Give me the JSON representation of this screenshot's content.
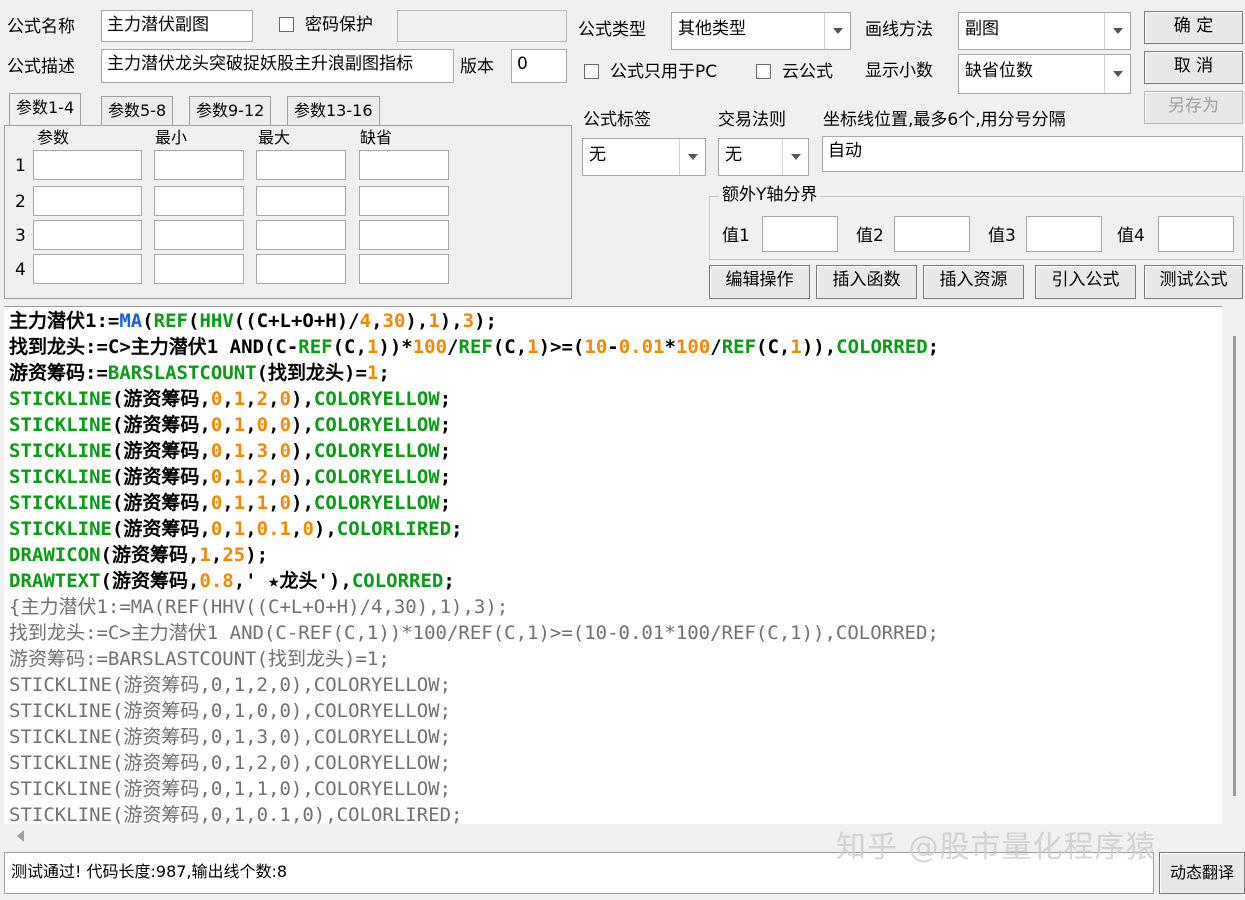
{
  "formula": {
    "name_label": "公式名称",
    "name_value": "主力潜伏副图",
    "password_label": "密码保护",
    "desc_label": "公式描述",
    "desc_value": "主力潜伏龙头突破捉妖股主升浪副图指标",
    "version_label": "版本",
    "version_value": "0",
    "type_label": "公式类型",
    "type_value": "其他类型",
    "draw_label": "画线方法",
    "draw_value": "副图",
    "pc_only_label": "公式只用于PC",
    "cloud_label": "云公式",
    "decimals_label": "显示小数",
    "decimals_value": "缺省位数",
    "tag_label": "公式标签",
    "tag_value": "无",
    "rule_label": "交易法则",
    "rule_value": "无",
    "coord_label": "坐标线位置,最多6个,用分号分隔",
    "coord_value": "自动"
  },
  "buttons": {
    "ok": "确 定",
    "cancel": "取 消",
    "save_as": "另存为",
    "edit_ops": "编辑操作",
    "insert_func": "插入函数",
    "insert_res": "插入资源",
    "import_formula": "引入公式",
    "test_formula": "测试公式",
    "dynamic_translate": "动态翻译"
  },
  "tabs": [
    "参数1-4",
    "参数5-8",
    "参数9-12",
    "参数13-16"
  ],
  "params": {
    "headers": [
      "参数",
      "最小",
      "最大",
      "缺省"
    ],
    "rows": [
      "1",
      "2",
      "3",
      "4"
    ]
  },
  "yaxis": {
    "title": "额外Y轴分界",
    "labels": [
      "值1",
      "值2",
      "值3",
      "值4"
    ]
  },
  "code_lines": [
    [
      {
        "t": "主力潜伏1:=",
        "c": "d"
      },
      {
        "t": "MA",
        "c": "b"
      },
      {
        "t": "(",
        "c": "d"
      },
      {
        "t": "REF",
        "c": "k"
      },
      {
        "t": "(",
        "c": "d"
      },
      {
        "t": "HHV",
        "c": "k"
      },
      {
        "t": "((C+L+O+H)/",
        "c": "d"
      },
      {
        "t": "4",
        "c": "n"
      },
      {
        "t": ",",
        "c": "d"
      },
      {
        "t": "30",
        "c": "n"
      },
      {
        "t": "),",
        "c": "d"
      },
      {
        "t": "1",
        "c": "n"
      },
      {
        "t": "),",
        "c": "d"
      },
      {
        "t": "3",
        "c": "n"
      },
      {
        "t": ");",
        "c": "d"
      }
    ],
    [
      {
        "t": "找到龙头:=C>主力潜伏1 AND(C-",
        "c": "d"
      },
      {
        "t": "REF",
        "c": "k"
      },
      {
        "t": "(C,",
        "c": "d"
      },
      {
        "t": "1",
        "c": "n"
      },
      {
        "t": "))*",
        "c": "d"
      },
      {
        "t": "100",
        "c": "n"
      },
      {
        "t": "/",
        "c": "d"
      },
      {
        "t": "REF",
        "c": "k"
      },
      {
        "t": "(C,",
        "c": "d"
      },
      {
        "t": "1",
        "c": "n"
      },
      {
        "t": ")>=(",
        "c": "d"
      },
      {
        "t": "10",
        "c": "n"
      },
      {
        "t": "-",
        "c": "d"
      },
      {
        "t": "0.01",
        "c": "n"
      },
      {
        "t": "*",
        "c": "d"
      },
      {
        "t": "100",
        "c": "n"
      },
      {
        "t": "/",
        "c": "d"
      },
      {
        "t": "REF",
        "c": "k"
      },
      {
        "t": "(C,",
        "c": "d"
      },
      {
        "t": "1",
        "c": "n"
      },
      {
        "t": ")),",
        "c": "d"
      },
      {
        "t": "COLORRED",
        "c": "k"
      },
      {
        "t": ";",
        "c": "d"
      }
    ],
    [
      {
        "t": "游资筹码:=",
        "c": "d"
      },
      {
        "t": "BARSLASTCOUNT",
        "c": "k"
      },
      {
        "t": "(找到龙头)=",
        "c": "d"
      },
      {
        "t": "1",
        "c": "n"
      },
      {
        "t": ";",
        "c": "d"
      }
    ],
    [
      {
        "t": "STICKLINE",
        "c": "k"
      },
      {
        "t": "(游资筹码,",
        "c": "d"
      },
      {
        "t": "0",
        "c": "n"
      },
      {
        "t": ",",
        "c": "d"
      },
      {
        "t": "1",
        "c": "n"
      },
      {
        "t": ",",
        "c": "d"
      },
      {
        "t": "2",
        "c": "n"
      },
      {
        "t": ",",
        "c": "d"
      },
      {
        "t": "0",
        "c": "n"
      },
      {
        "t": "),",
        "c": "d"
      },
      {
        "t": "COLORYELLOW",
        "c": "k"
      },
      {
        "t": ";",
        "c": "d"
      }
    ],
    [
      {
        "t": "STICKLINE",
        "c": "k"
      },
      {
        "t": "(游资筹码,",
        "c": "d"
      },
      {
        "t": "0",
        "c": "n"
      },
      {
        "t": ",",
        "c": "d"
      },
      {
        "t": "1",
        "c": "n"
      },
      {
        "t": ",",
        "c": "d"
      },
      {
        "t": "0",
        "c": "n"
      },
      {
        "t": ",",
        "c": "d"
      },
      {
        "t": "0",
        "c": "n"
      },
      {
        "t": "),",
        "c": "d"
      },
      {
        "t": "COLORYELLOW",
        "c": "k"
      },
      {
        "t": ";",
        "c": "d"
      }
    ],
    [
      {
        "t": "STICKLINE",
        "c": "k"
      },
      {
        "t": "(游资筹码,",
        "c": "d"
      },
      {
        "t": "0",
        "c": "n"
      },
      {
        "t": ",",
        "c": "d"
      },
      {
        "t": "1",
        "c": "n"
      },
      {
        "t": ",",
        "c": "d"
      },
      {
        "t": "3",
        "c": "n"
      },
      {
        "t": ",",
        "c": "d"
      },
      {
        "t": "0",
        "c": "n"
      },
      {
        "t": "),",
        "c": "d"
      },
      {
        "t": "COLORYELLOW",
        "c": "k"
      },
      {
        "t": ";",
        "c": "d"
      }
    ],
    [
      {
        "t": "STICKLINE",
        "c": "k"
      },
      {
        "t": "(游资筹码,",
        "c": "d"
      },
      {
        "t": "0",
        "c": "n"
      },
      {
        "t": ",",
        "c": "d"
      },
      {
        "t": "1",
        "c": "n"
      },
      {
        "t": ",",
        "c": "d"
      },
      {
        "t": "2",
        "c": "n"
      },
      {
        "t": ",",
        "c": "d"
      },
      {
        "t": "0",
        "c": "n"
      },
      {
        "t": "),",
        "c": "d"
      },
      {
        "t": "COLORYELLOW",
        "c": "k"
      },
      {
        "t": ";",
        "c": "d"
      }
    ],
    [
      {
        "t": "STICKLINE",
        "c": "k"
      },
      {
        "t": "(游资筹码,",
        "c": "d"
      },
      {
        "t": "0",
        "c": "n"
      },
      {
        "t": ",",
        "c": "d"
      },
      {
        "t": "1",
        "c": "n"
      },
      {
        "t": ",",
        "c": "d"
      },
      {
        "t": "1",
        "c": "n"
      },
      {
        "t": ",",
        "c": "d"
      },
      {
        "t": "0",
        "c": "n"
      },
      {
        "t": "),",
        "c": "d"
      },
      {
        "t": "COLORYELLOW",
        "c": "k"
      },
      {
        "t": ";",
        "c": "d"
      }
    ],
    [
      {
        "t": "STICKLINE",
        "c": "k"
      },
      {
        "t": "(游资筹码,",
        "c": "d"
      },
      {
        "t": "0",
        "c": "n"
      },
      {
        "t": ",",
        "c": "d"
      },
      {
        "t": "1",
        "c": "n"
      },
      {
        "t": ",",
        "c": "d"
      },
      {
        "t": "0.1",
        "c": "n"
      },
      {
        "t": ",",
        "c": "d"
      },
      {
        "t": "0",
        "c": "n"
      },
      {
        "t": "),",
        "c": "d"
      },
      {
        "t": "COLORLIRED",
        "c": "k"
      },
      {
        "t": ";",
        "c": "d"
      }
    ],
    [
      {
        "t": "DRAWICON",
        "c": "k"
      },
      {
        "t": "(游资筹码,",
        "c": "d"
      },
      {
        "t": "1",
        "c": "n"
      },
      {
        "t": ",",
        "c": "d"
      },
      {
        "t": "25",
        "c": "n"
      },
      {
        "t": ");",
        "c": "d"
      }
    ],
    [
      {
        "t": "DRAWTEXT",
        "c": "k"
      },
      {
        "t": "(游资筹码,",
        "c": "d"
      },
      {
        "t": "0.8",
        "c": "n"
      },
      {
        "t": ",' ★龙头'),",
        "c": "d"
      },
      {
        "t": "COLORRED",
        "c": "k"
      },
      {
        "t": ";",
        "c": "d"
      }
    ],
    [
      {
        "t": "{主力潜伏1:=MA(REF(HHV((C+L+O+H)/4,30),1),3);",
        "c": "g"
      }
    ],
    [
      {
        "t": "找到龙头:=C>主力潜伏1 AND(C-REF(C,1))*100/REF(C,1)>=(10-0.01*100/REF(C,1)),COLORRED;",
        "c": "g"
      }
    ],
    [
      {
        "t": "游资筹码:=BARSLASTCOUNT(找到龙头)=1;",
        "c": "g"
      }
    ],
    [
      {
        "t": "STICKLINE(游资筹码,0,1,2,0),COLORYELLOW;",
        "c": "g"
      }
    ],
    [
      {
        "t": "STICKLINE(游资筹码,0,1,0,0),COLORYELLOW;",
        "c": "g"
      }
    ],
    [
      {
        "t": "STICKLINE(游资筹码,0,1,3,0),COLORYELLOW;",
        "c": "g"
      }
    ],
    [
      {
        "t": "STICKLINE(游资筹码,0,1,2,0),COLORYELLOW;",
        "c": "g"
      }
    ],
    [
      {
        "t": "STICKLINE(游资筹码,0,1,1,0),COLORYELLOW;",
        "c": "g"
      }
    ],
    [
      {
        "t": "STICKLINE(游资筹码,0,1,0.1,0),COLORLIRED;",
        "c": "g"
      }
    ]
  ],
  "status": "测试通过! 代码长度:987,输出线个数:8",
  "watermark": "知乎 @股市量化程序猿",
  "colors": {
    "keyword": "#0a9a16",
    "number": "#f08a00",
    "builtin": "#1860e0",
    "comment": "#707070",
    "background": "#f0f0f0"
  }
}
